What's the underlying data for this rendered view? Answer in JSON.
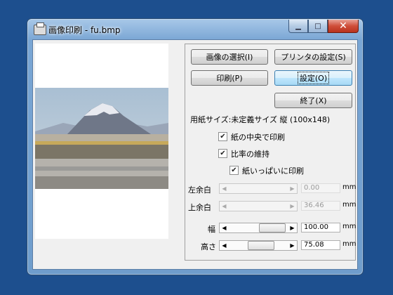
{
  "window": {
    "title": "画像印刷 - fu.bmp",
    "minimize": "▁",
    "maximize": "□",
    "close": "✕"
  },
  "buttons": {
    "select_image": "画像の選択(I)",
    "printer_settings": "プリンタの設定(S)",
    "print": "印刷(P)",
    "settings": "設定(O)",
    "exit": "終了(X)"
  },
  "paper_info": "用紙サイズ:未定義サイズ 縦 (100x148)",
  "options": {
    "center": {
      "label": "紙の中央で印刷",
      "checked": true
    },
    "keep_ratio": {
      "label": "比率の維持",
      "checked": true
    },
    "fill_paper": {
      "label": "紙いっぱいに印刷",
      "checked": true
    }
  },
  "fields": {
    "left_margin": {
      "label": "左余白",
      "value": "0.00",
      "unit": "mm"
    },
    "top_margin": {
      "label": "上余白",
      "value": "36.46",
      "unit": "mm"
    },
    "width": {
      "label": "幅",
      "value": "100.00",
      "unit": "mm"
    },
    "height": {
      "label": "高さ",
      "value": "75.08",
      "unit": "mm"
    }
  },
  "icons": {
    "left_arrow": "◀",
    "right_arrow": "▶",
    "check": "✔"
  }
}
